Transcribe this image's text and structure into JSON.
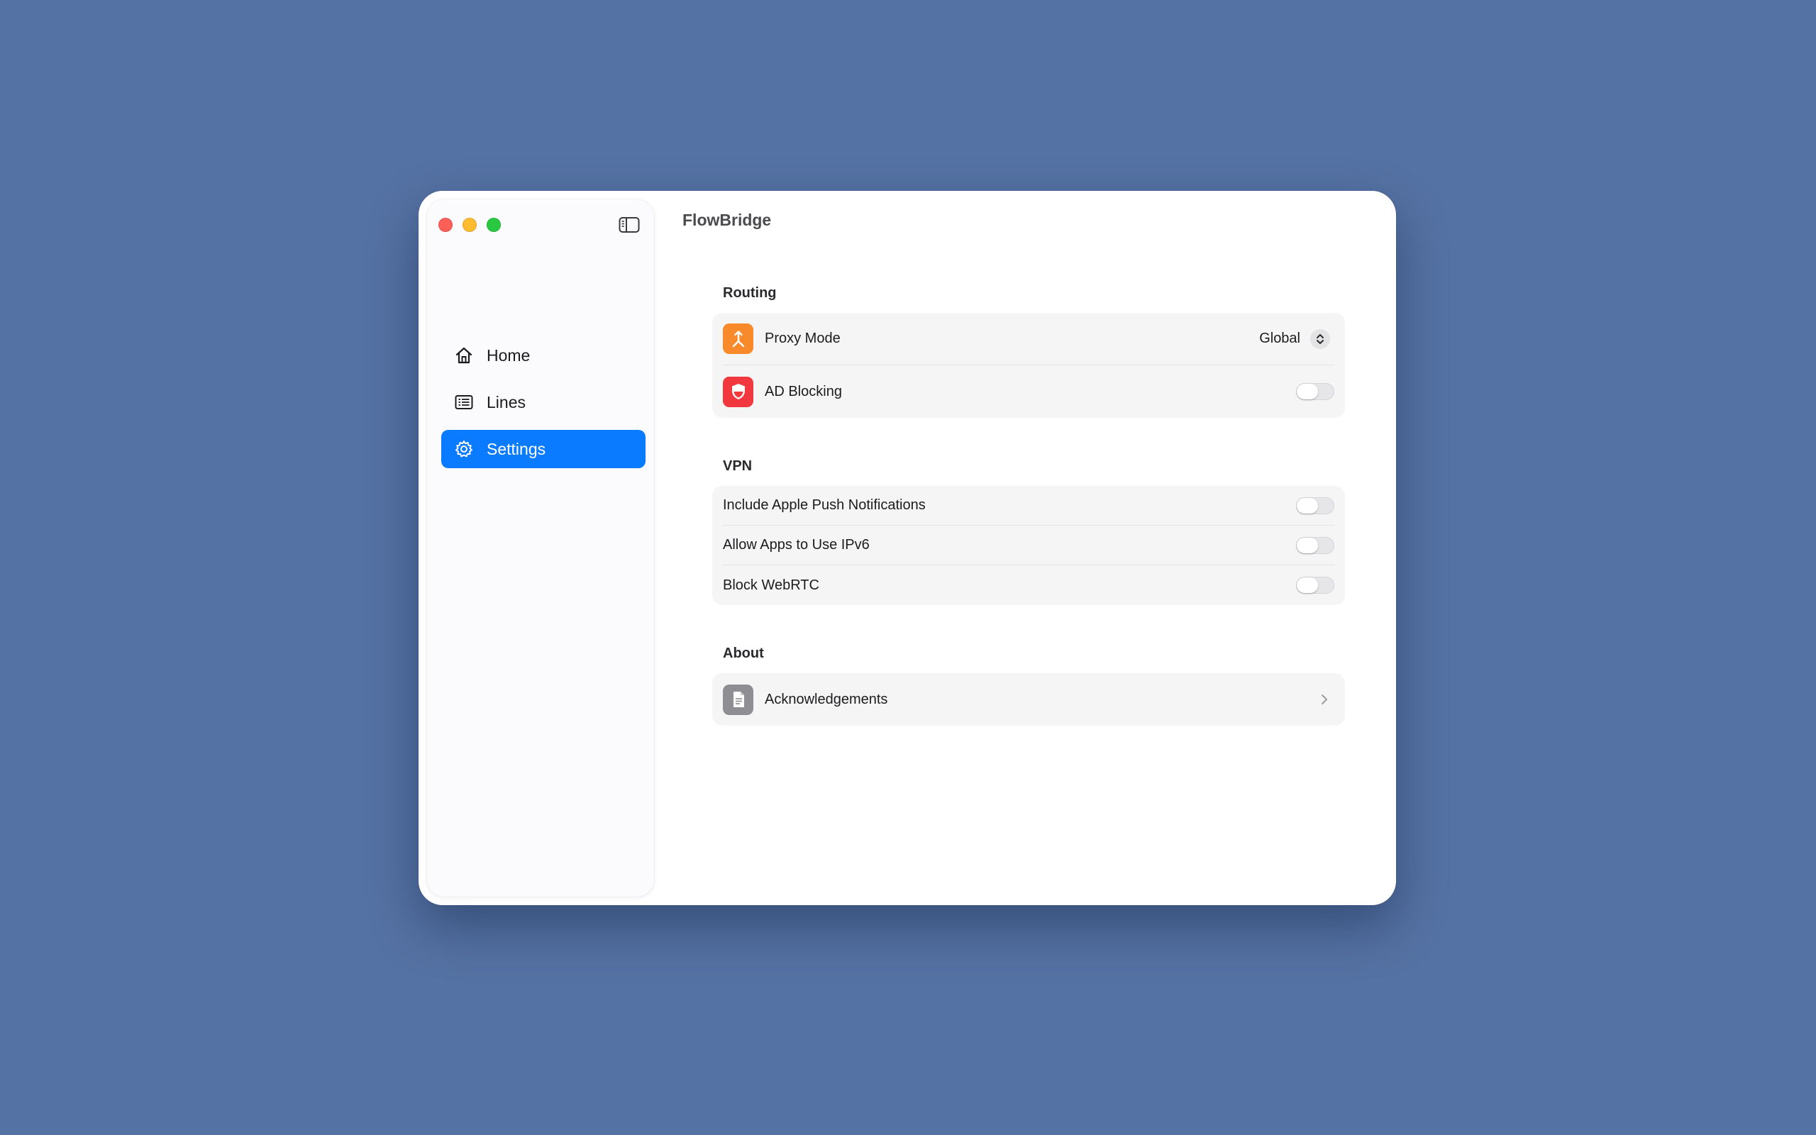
{
  "window": {
    "title": "FlowBridge"
  },
  "sidebar": {
    "items": [
      {
        "label": "Home",
        "icon": "house-icon",
        "active": false
      },
      {
        "label": "Lines",
        "icon": "list-icon",
        "active": false
      },
      {
        "label": "Settings",
        "icon": "gear-icon",
        "active": true
      }
    ]
  },
  "sections": {
    "routing": {
      "title": "Routing",
      "proxy_mode": {
        "label": "Proxy Mode",
        "value": "Global",
        "icon": "proxy-mode-icon",
        "icon_color": "#f98a2b"
      },
      "ad_blocking": {
        "label": "AD Blocking",
        "enabled": false,
        "icon": "shield-icon",
        "icon_color": "#f0383e"
      }
    },
    "vpn": {
      "title": "VPN",
      "include_apns": {
        "label": "Include Apple Push Notifications",
        "enabled": false
      },
      "allow_ipv6": {
        "label": "Allow Apps to Use IPv6",
        "enabled": false
      },
      "block_webrtc": {
        "label": "Block WebRTC",
        "enabled": false
      }
    },
    "about": {
      "title": "About",
      "acknowledgements": {
        "label": "Acknowledgements",
        "icon": "document-icon",
        "icon_color": "#8e8e93"
      }
    }
  },
  "colors": {
    "accent": "#0a7bff",
    "desktop": "#5472a3"
  }
}
